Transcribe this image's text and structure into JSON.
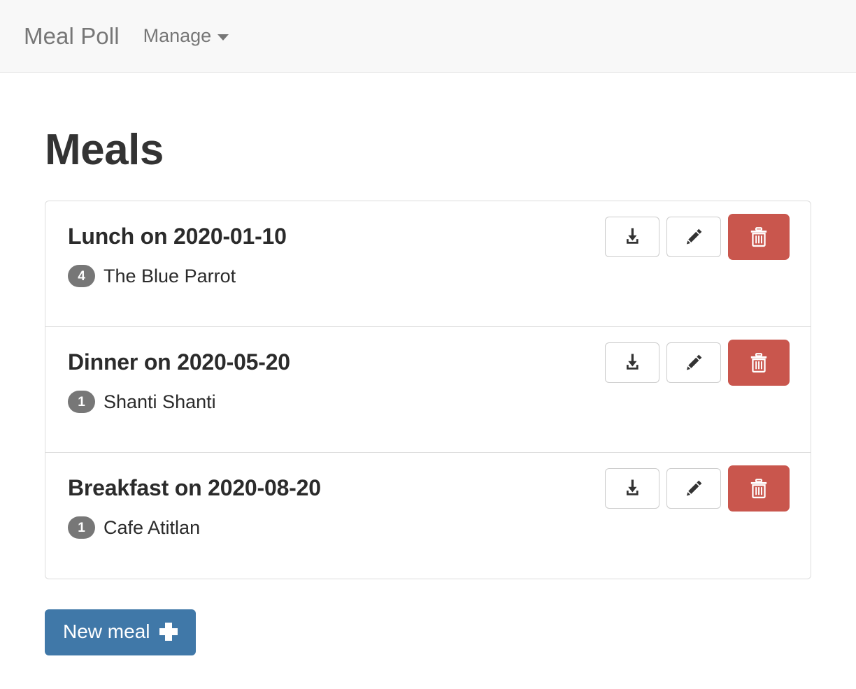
{
  "navbar": {
    "brand": "Meal Poll",
    "menu_label": "Manage",
    "caret_icon": "chevron-down-icon"
  },
  "page": {
    "title": "Meals"
  },
  "meals": [
    {
      "title": "Lunch on 2020-01-10",
      "votes": "4",
      "restaurant": "The Blue Parrot",
      "download_icon": "download-icon",
      "edit_icon": "pencil-icon",
      "delete_icon": "trash-icon"
    },
    {
      "title": "Dinner on 2020-05-20",
      "votes": "1",
      "restaurant": "Shanti Shanti",
      "download_icon": "download-icon",
      "edit_icon": "pencil-icon",
      "delete_icon": "trash-icon"
    },
    {
      "title": "Breakfast on 2020-08-20",
      "votes": "1",
      "restaurant": "Cafe Atitlan",
      "download_icon": "download-icon",
      "edit_icon": "pencil-icon",
      "delete_icon": "trash-icon"
    }
  ],
  "new_meal_button": {
    "label": "New meal",
    "icon": "plus-icon"
  },
  "colors": {
    "navbar_bg": "#f8f8f8",
    "navbar_border": "#e7e7e7",
    "nav_text": "#777777",
    "heading": "#333333",
    "badge_bg": "#777777",
    "danger": "#c9564d",
    "primary": "#4078a8",
    "border": "#dddddd"
  }
}
